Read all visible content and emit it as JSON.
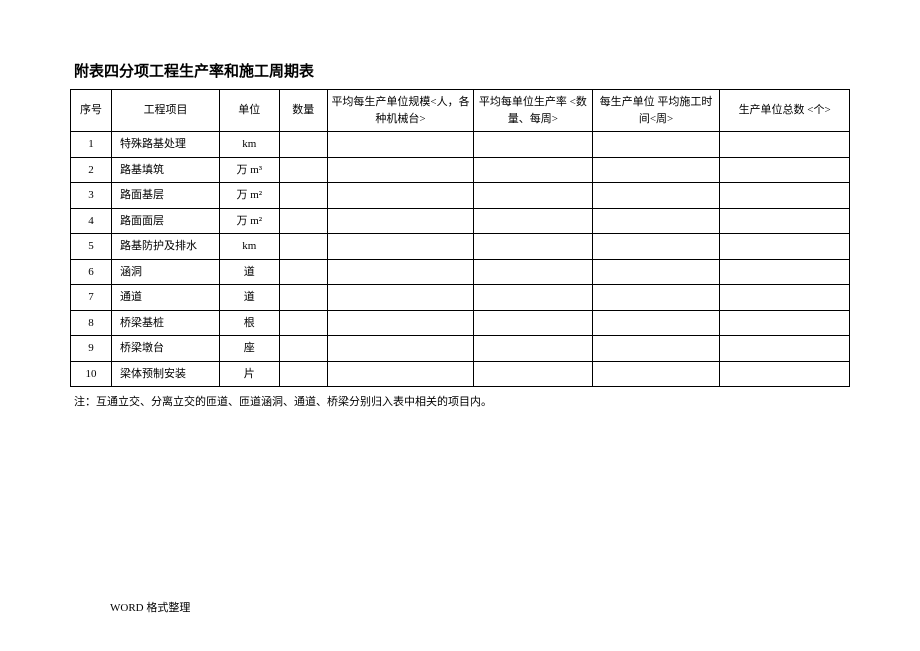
{
  "title": "附表四分项工程生产率和施工周期表",
  "headers": {
    "seq": "序号",
    "project": "工程项目",
    "unit": "单位",
    "qty": "数量",
    "scale": "平均每生产单位规模<人，各种机械台>",
    "rate": "平均每单位生产率\n<数量、每周>",
    "time": "每生产单位 平均施工时间<周>",
    "total": "生产单位总数\n<个>"
  },
  "rows": [
    {
      "seq": "1",
      "project": "特殊路基处理",
      "unit": "km",
      "qty": "",
      "scale": "",
      "rate": "",
      "time": "",
      "total": ""
    },
    {
      "seq": "2",
      "project": "路基填筑",
      "unit": "万 m³",
      "qty": "",
      "scale": "",
      "rate": "",
      "time": "",
      "total": ""
    },
    {
      "seq": "3",
      "project": "路面基层",
      "unit": "万 m²",
      "qty": "",
      "scale": "",
      "rate": "",
      "time": "",
      "total": ""
    },
    {
      "seq": "4",
      "project": "路面面层",
      "unit": "万 m²",
      "qty": "",
      "scale": "",
      "rate": "",
      "time": "",
      "total": ""
    },
    {
      "seq": "5",
      "project": "路基防护及排水",
      "unit": "km",
      "qty": "",
      "scale": "",
      "rate": "",
      "time": "",
      "total": ""
    },
    {
      "seq": "6",
      "project": "涵洞",
      "unit": "道",
      "qty": "",
      "scale": "",
      "rate": "",
      "time": "",
      "total": ""
    },
    {
      "seq": "7",
      "project": "通道",
      "unit": "道",
      "qty": "",
      "scale": "",
      "rate": "",
      "time": "",
      "total": ""
    },
    {
      "seq": "8",
      "project": "桥梁基桩",
      "unit": "根",
      "qty": "",
      "scale": "",
      "rate": "",
      "time": "",
      "total": ""
    },
    {
      "seq": "9",
      "project": "桥梁墩台",
      "unit": "座",
      "qty": "",
      "scale": "",
      "rate": "",
      "time": "",
      "total": ""
    },
    {
      "seq": "10",
      "project": "梁体预制安装",
      "unit": "片",
      "qty": "",
      "scale": "",
      "rate": "",
      "time": "",
      "total": ""
    }
  ],
  "note": "注：互通立交、分离立交的匝道、匝道涵洞、通道、桥梁分别归入表中相关的项目内。",
  "footer": "WORD 格式整理"
}
